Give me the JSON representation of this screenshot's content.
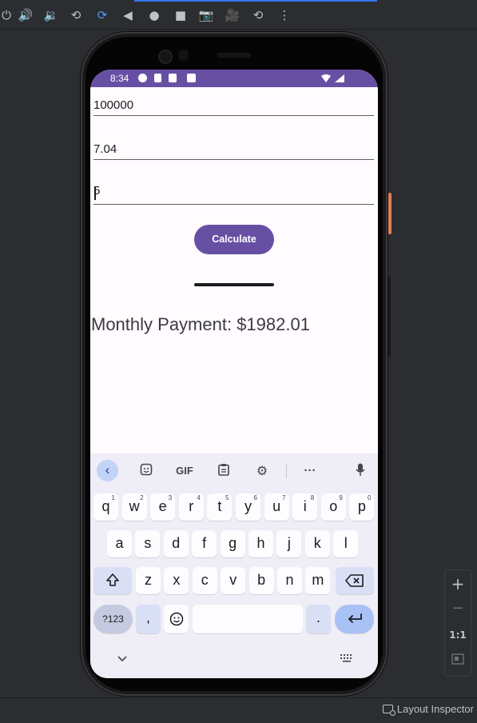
{
  "emulator_toolbar": {
    "buttons": [
      {
        "icon": "power-icon",
        "glyph": "⏻"
      },
      {
        "icon": "volume-up-icon",
        "glyph": "🔊"
      },
      {
        "icon": "volume-down-icon",
        "glyph": "🔉"
      },
      {
        "icon": "rotate-left-icon",
        "glyph": "⟲"
      },
      {
        "icon": "rotate-right-icon",
        "glyph": "⟳"
      },
      {
        "icon": "back-icon",
        "glyph": "◀"
      },
      {
        "icon": "home-icon",
        "glyph": "●"
      },
      {
        "icon": "overview-icon",
        "glyph": "■"
      },
      {
        "icon": "screenshot-camera-icon",
        "glyph": "📷"
      },
      {
        "icon": "screen-record-icon",
        "glyph": "🎥"
      },
      {
        "icon": "snapshot-history-icon",
        "glyph": "⟲"
      },
      {
        "icon": "more-icon",
        "glyph": "⋮"
      }
    ]
  },
  "phone": {
    "status_bar": {
      "time": "8:34"
    },
    "inputs": [
      {
        "value": "100000"
      },
      {
        "value": "7.04"
      },
      {
        "value": "5"
      }
    ],
    "calculate_label": "Calculate",
    "result_text": "Monthly Payment: $1982.01"
  },
  "keyboard": {
    "toolbar": {
      "gif_label": "GIF"
    },
    "row1": [
      [
        "q",
        "1"
      ],
      [
        "w",
        "2"
      ],
      [
        "e",
        "3"
      ],
      [
        "r",
        "4"
      ],
      [
        "t",
        "5"
      ],
      [
        "y",
        "6"
      ],
      [
        "u",
        "7"
      ],
      [
        "i",
        "8"
      ],
      [
        "o",
        "9"
      ],
      [
        "p",
        "0"
      ]
    ],
    "row2": [
      "a",
      "s",
      "d",
      "f",
      "g",
      "h",
      "j",
      "k",
      "l"
    ],
    "row3": [
      "z",
      "x",
      "c",
      "v",
      "b",
      "n",
      "m"
    ],
    "symbols_label": "?123",
    "comma_label": ",",
    "period_label": "."
  },
  "side_panel": {
    "zoom_in": "+",
    "zoom_out": "−",
    "actual_size": "1:1"
  },
  "bottom_bar": {
    "layout_inspector_label": "Layout Inspector"
  },
  "colors": {
    "accent": "#6750a4",
    "ide_bg": "#2b2d30",
    "key_blue": "#a9c2f5"
  }
}
